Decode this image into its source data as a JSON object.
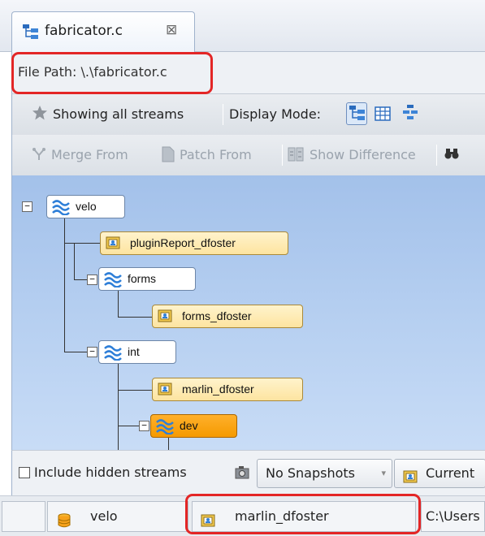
{
  "tab": {
    "title": "fabricator.c",
    "close": "⊠",
    "icon": "stream-browser-icon"
  },
  "path_bar": {
    "text": "File Path: \\.\\fabricator.c"
  },
  "toolbar1": {
    "showing": "Showing all streams",
    "display_mode": "Display Mode:"
  },
  "toolbar2": {
    "merge": "Merge From",
    "patch": "Patch From",
    "diff": "Show Difference"
  },
  "tree": {
    "velo": "velo",
    "pluginreport": "pluginReport_dfoster",
    "forms": "forms",
    "forms_dfoster": "forms_dfoster",
    "int": "int",
    "marlin": "marlin_dfoster",
    "dev": "dev",
    "collapse_glyph": "−"
  },
  "options": {
    "include_hidden": "Include hidden streams",
    "snapshots": "No Snapshots",
    "current": "Current"
  },
  "status": {
    "stream": "velo",
    "workspace": "marlin_dfoster",
    "path": "C:\\Users"
  },
  "colors": {
    "highlight_box": "#e32626",
    "selected_node": "#f59a00",
    "canvas": "#b7d0f1"
  }
}
